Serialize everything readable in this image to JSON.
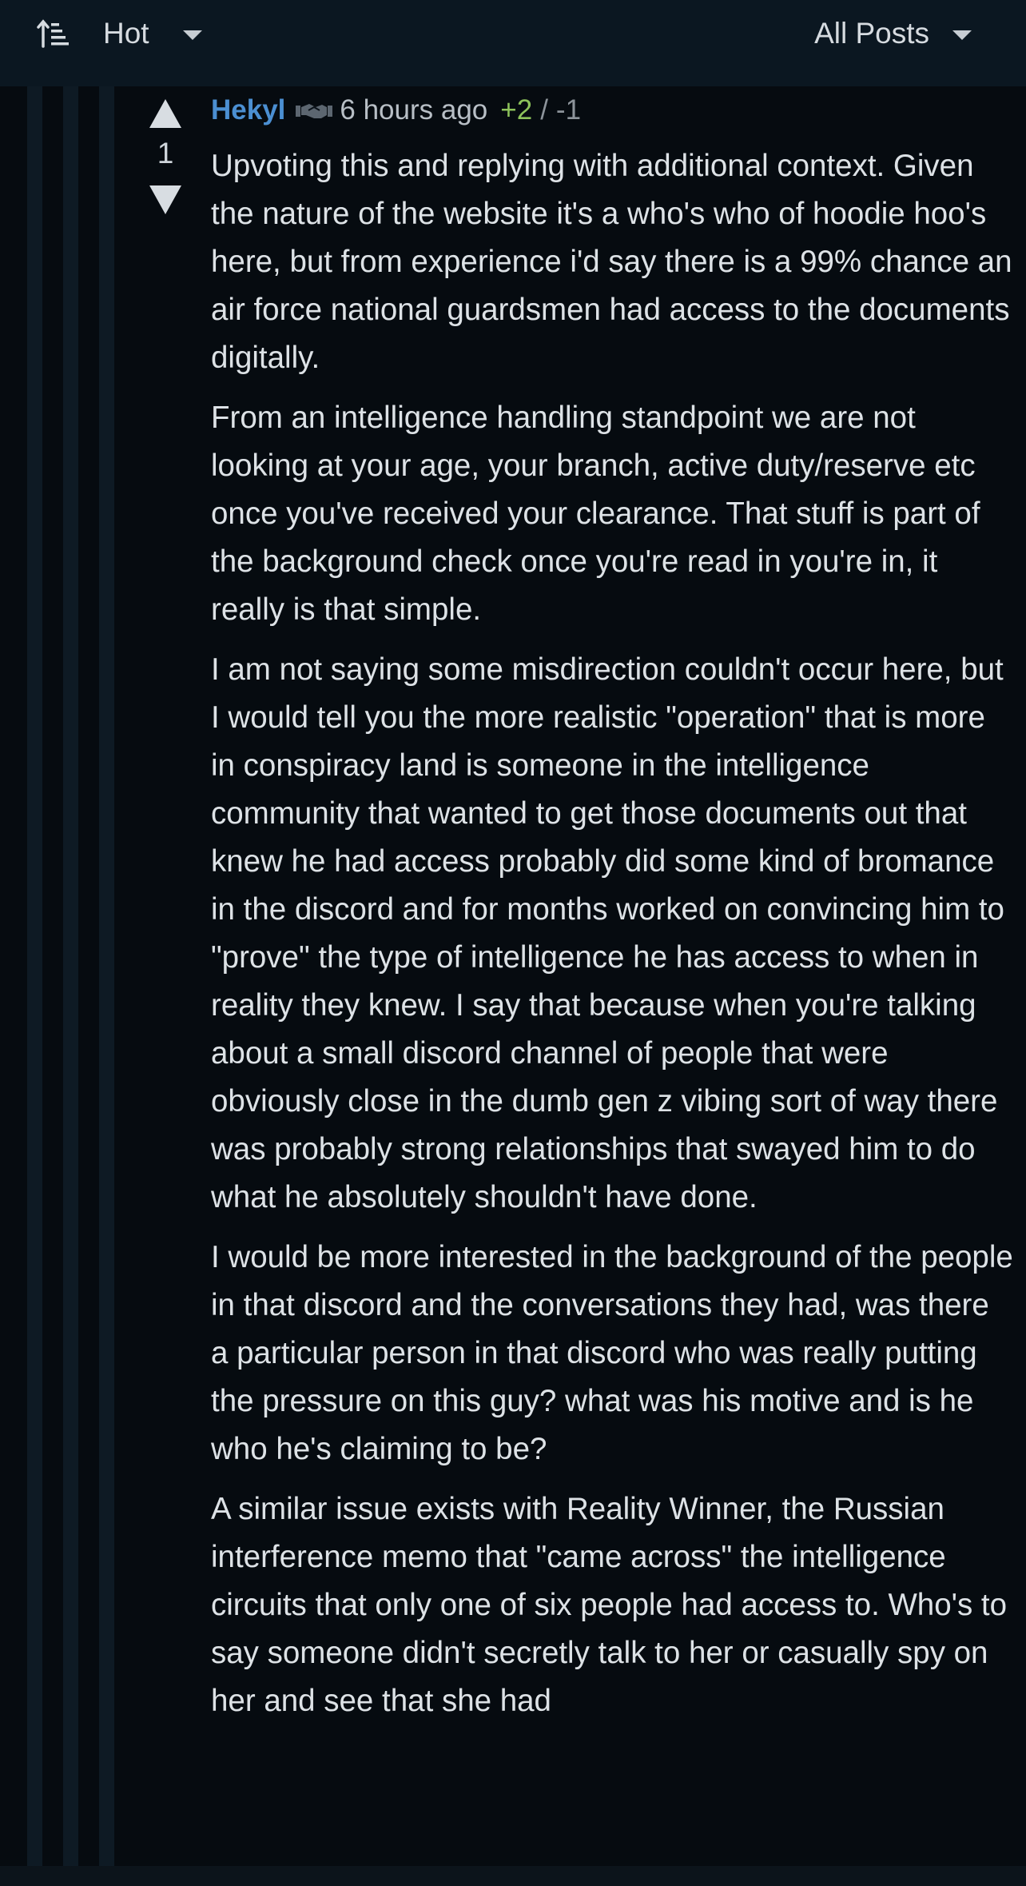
{
  "header": {
    "sort_label": "Hot",
    "filter_label": "All Posts"
  },
  "comment": {
    "author": "Hekyl",
    "time": "6 hours ago",
    "score_up": "+2",
    "score_sep": "/",
    "score_down": "-1",
    "vote_count": "1",
    "paragraphs": [
      "Upvoting this and replying with additional context. Given the nature of the website it's a who's who of hoodie hoo's here, but from experience i'd say there is a 99% chance an air force national guardsmen had access to the documents digitally.",
      "From an intelligence handling standpoint we are not looking at your age, your branch, active duty/reserve etc once you've received your clearance. That stuff is part of the background check once you're read in you're in, it really is that simple.",
      "I am not saying some misdirection couldn't occur here, but I would tell you the more realistic \"operation\" that is more in conspiracy land is someone in the intelligence community that wanted to get those documents out that knew he had access probably did some kind of bromance in the discord and for months worked on convincing him to \"prove\" the type of intelligence he has access to when in reality they knew. I say that because when you're talking about a small discord channel of people that were obviously close in the dumb gen z vibing sort of way there was probably strong relationships that swayed him to do what he absolutely shouldn't have done.",
      "I would be more interested in the background of the people in that discord and the conversations they had, was there a particular person in that discord who was really putting the pressure on this guy? what was his motive and is he who he's claiming to be?",
      "A similar issue exists with Reality Winner, the Russian interference memo that \"came across\" the intelligence circuits that only one of six people had access to. Who's to say someone didn't secretly talk to her or casually spy on her and see that she had"
    ]
  },
  "icons": {
    "sort": "sort-lines-icon",
    "caret": "caret-down-icon",
    "upvote": "upvote-arrow-icon",
    "downvote": "downvote-arrow-icon",
    "flair": "handshake-icon"
  },
  "colors": {
    "background": "#060b10",
    "topbar": "#0b1721",
    "author": "#4b8fd2",
    "score_positive": "#8dc35b",
    "text": "#dde2e6"
  }
}
